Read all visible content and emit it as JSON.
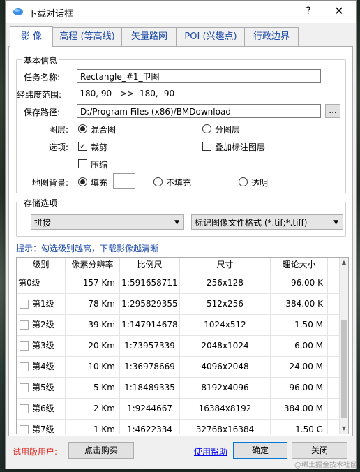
{
  "window": {
    "title": "下载对话框",
    "help_glyph": "?",
    "close_glyph": "✕"
  },
  "tabs": [
    {
      "label": "影 像",
      "active": true
    },
    {
      "label": "高程 (等高线)"
    },
    {
      "label": "矢量路网"
    },
    {
      "label": "POI (兴趣点)"
    },
    {
      "label": "行政边界"
    }
  ],
  "basic": {
    "group_title": "基本信息",
    "task_name_label": "任务名称:",
    "task_name_value": "Rectangle_#1_卫图",
    "range_label": "经纬度范围:",
    "range_from": "-180, 90",
    "range_arrow": ">>",
    "range_to": "180, -90",
    "save_path_label": "保存路径:",
    "save_path_value": "D:/Program Files (x86)/BMDownload",
    "browse_label": "...",
    "layer_label": "图层:",
    "layer_mixed": "混合图",
    "layer_split": "分图层",
    "options_label": "选项:",
    "opt_crop": "裁剪",
    "opt_overlay": "叠加标注图层",
    "opt_compress": "压缩",
    "bg_label": "地图背景:",
    "bg_fill": "填充",
    "bg_nofill": "不填充",
    "bg_transparent": "透明",
    "bg_fill_color": "#ffffff"
  },
  "storage": {
    "group_title": "存储选项",
    "mode_value": "拼接",
    "format_value": "标记图像文件格式 (*.tif;*.tiff)"
  },
  "hint": "提示：勾选级别越高，下载影像越清晰",
  "table": {
    "columns": [
      "级别",
      "像素分辨率",
      "比例尺",
      "尺寸",
      "理论大小"
    ],
    "rows": [
      {
        "level": "第0级",
        "res": "157 Km",
        "scale": "1:591658711",
        "size": "256x128",
        "est": "96.00 K",
        "checkbox": false
      },
      {
        "level": "第1级",
        "res": "78 Km",
        "scale": "1:295829355",
        "size": "512x256",
        "est": "384.00 K",
        "checkbox": true
      },
      {
        "level": "第2级",
        "res": "39 Km",
        "scale": "1:147914678",
        "size": "1024x512",
        "est": "1.50 M",
        "checkbox": true
      },
      {
        "level": "第3级",
        "res": "20 Km",
        "scale": "1:73957339",
        "size": "2048x1024",
        "est": "6.00 M",
        "checkbox": true
      },
      {
        "level": "第4级",
        "res": "10 Km",
        "scale": "1:36978669",
        "size": "4096x2048",
        "est": "24.00 M",
        "checkbox": true
      },
      {
        "level": "第5级",
        "res": "5 Km",
        "scale": "1:18489335",
        "size": "8192x4096",
        "est": "96.00 M",
        "checkbox": true
      },
      {
        "level": "第6级",
        "res": "2 Km",
        "scale": "1:9244667",
        "size": "16384x8192",
        "est": "384.00 M",
        "checkbox": true
      },
      {
        "level": "第7级",
        "res": "1 Km",
        "scale": "1:4622334",
        "size": "32768x16384",
        "est": "1.50 G",
        "checkbox": true
      }
    ]
  },
  "footer": {
    "trial_label": "试用版用户:",
    "buy_label": "点击购买",
    "help_link": "使用帮助",
    "ok_label": "确定",
    "close_label": "关闭"
  },
  "watermark": "@稀土掘金技术社区"
}
